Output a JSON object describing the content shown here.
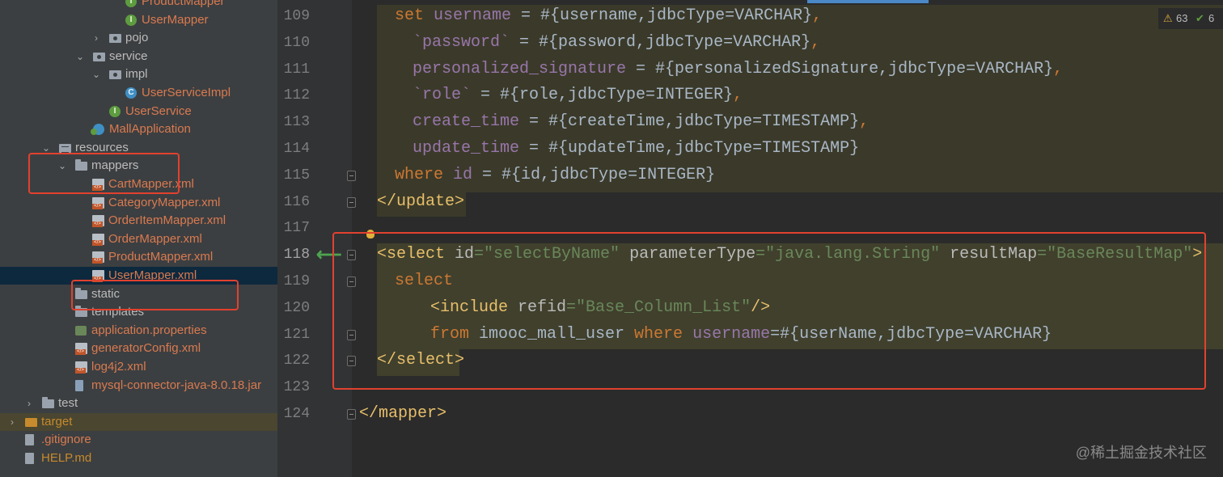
{
  "project_tree": {
    "items": [
      {
        "label": "ProductMapper",
        "icon": "interface-icon",
        "color": "orange",
        "indent": 155,
        "arrow": ""
      },
      {
        "label": "UserMapper",
        "icon": "interface-icon",
        "color": "orange",
        "indent": 155,
        "arrow": ""
      },
      {
        "label": "pojo",
        "icon": "package-icon",
        "color": "gray",
        "indent": 135,
        "arrow": "›"
      },
      {
        "label": "service",
        "icon": "package-icon",
        "color": "gray",
        "indent": 115,
        "arrow": "⌄"
      },
      {
        "label": "impl",
        "icon": "package-icon",
        "color": "gray",
        "indent": 135,
        "arrow": "⌄"
      },
      {
        "label": "UserServiceImpl",
        "icon": "class-icon",
        "color": "orange",
        "indent": 155,
        "arrow": ""
      },
      {
        "label": "UserService",
        "icon": "interface-icon",
        "color": "orange",
        "indent": 135,
        "arrow": ""
      },
      {
        "label": "MallApplication",
        "icon": "spring-app-icon",
        "color": "orange",
        "indent": 115,
        "arrow": ""
      },
      {
        "label": "resources",
        "icon": "resources-folder-icon",
        "color": "gray",
        "indent": 73,
        "arrow": "⌄"
      },
      {
        "label": "mappers",
        "icon": "folder-icon",
        "color": "gray",
        "indent": 93,
        "arrow": "⌄"
      },
      {
        "label": "CartMapper.xml",
        "icon": "xml-file-icon",
        "color": "orange",
        "indent": 114,
        "arrow": ""
      },
      {
        "label": "CategoryMapper.xml",
        "icon": "xml-file-icon",
        "color": "orange",
        "indent": 114,
        "arrow": ""
      },
      {
        "label": "OrderItemMapper.xml",
        "icon": "xml-file-icon",
        "color": "orange",
        "indent": 114,
        "arrow": ""
      },
      {
        "label": "OrderMapper.xml",
        "icon": "xml-file-icon",
        "color": "orange",
        "indent": 114,
        "arrow": ""
      },
      {
        "label": "ProductMapper.xml",
        "icon": "xml-file-icon",
        "color": "orange",
        "indent": 114,
        "arrow": ""
      },
      {
        "label": "UserMapper.xml",
        "icon": "xml-file-icon",
        "color": "orange",
        "indent": 114,
        "arrow": "",
        "selected": true
      },
      {
        "label": "static",
        "icon": "folder-icon",
        "color": "gray",
        "indent": 93,
        "arrow": ""
      },
      {
        "label": "templates",
        "icon": "folder-icon",
        "color": "gray",
        "indent": 93,
        "arrow": ""
      },
      {
        "label": "application.properties",
        "icon": "properties-file-icon",
        "color": "orange",
        "indent": 93,
        "arrow": ""
      },
      {
        "label": "generatorConfig.xml",
        "icon": "xml-file-icon",
        "color": "orange",
        "indent": 93,
        "arrow": ""
      },
      {
        "label": "log4j2.xml",
        "icon": "xml-file-icon",
        "color": "orange",
        "indent": 93,
        "arrow": ""
      },
      {
        "label": "mysql-connector-java-8.0.18.jar",
        "icon": "jar-file-icon",
        "color": "orange",
        "indent": 93,
        "arrow": ""
      },
      {
        "label": "test",
        "icon": "folder-icon",
        "color": "gray",
        "indent": 52,
        "arrow": "›"
      },
      {
        "label": "target",
        "icon": "target-folder-icon",
        "color": "gold",
        "indent": 31,
        "arrow": "›",
        "target": true
      },
      {
        "label": ".gitignore",
        "icon": "gitignore-file-icon",
        "color": "orange",
        "indent": 31,
        "arrow": ""
      },
      {
        "label": "HELP.md",
        "icon": "markdown-file-icon",
        "color": "gold",
        "indent": 31,
        "arrow": ""
      }
    ]
  },
  "editor": {
    "warnings": {
      "warning_count": "63",
      "ok_count": "6"
    },
    "lines": [
      {
        "num": "109",
        "html": [
          [
            "k",
            "set "
          ],
          [
            "v",
            "username"
          ],
          [
            "tp",
            " = #{username,jdbcType=VARCHAR}"
          ],
          [
            "k",
            ","
          ]
        ],
        "indent": 1
      },
      {
        "num": "110",
        "html": [
          [
            "v",
            "`password`"
          ],
          [
            "tp",
            " = #{password,jdbcType=VARCHAR}"
          ],
          [
            "k",
            ","
          ]
        ],
        "indent": 2
      },
      {
        "num": "111",
        "html": [
          [
            "v",
            "personalized_signature"
          ],
          [
            "tp",
            " = #{personalizedSignature,jdbcType=VARCHAR}"
          ],
          [
            "k",
            ","
          ]
        ],
        "indent": 2
      },
      {
        "num": "112",
        "html": [
          [
            "v",
            "`role`"
          ],
          [
            "tp",
            " = #{role,jdbcType=INTEGER}"
          ],
          [
            "k",
            ","
          ]
        ],
        "indent": 2
      },
      {
        "num": "113",
        "html": [
          [
            "v",
            "create_time"
          ],
          [
            "tp",
            " = #{createTime,jdbcType=TIMESTAMP}"
          ],
          [
            "k",
            ","
          ]
        ],
        "indent": 2
      },
      {
        "num": "114",
        "html": [
          [
            "v",
            "update_time"
          ],
          [
            "tp",
            " = #{updateTime,jdbcType=TIMESTAMP}"
          ]
        ],
        "indent": 2
      },
      {
        "num": "115",
        "html": [
          [
            "k",
            "where "
          ],
          [
            "v",
            "id"
          ],
          [
            "tp",
            " = #{id,jdbcType=INTEGER}"
          ]
        ],
        "indent": 1
      },
      {
        "num": "116",
        "html": [
          [
            "tg",
            "</update>"
          ]
        ],
        "indent": 0
      },
      {
        "num": "117",
        "html": [],
        "indent": 0
      },
      {
        "num": "118",
        "html": [
          [
            "tg",
            "<select "
          ],
          [
            "at",
            "id"
          ],
          [
            "s",
            "=\"selectByName\" "
          ],
          [
            "at",
            "parameterType"
          ],
          [
            "s",
            "=\"java.lang.String\" "
          ],
          [
            "at",
            "resultMap"
          ],
          [
            "s",
            "=\"BaseResultMap\""
          ],
          [
            "tg",
            ">"
          ]
        ],
        "indent": 0
      },
      {
        "num": "119",
        "html": [
          [
            "k",
            "select"
          ]
        ],
        "indent": 1
      },
      {
        "num": "120",
        "html": [
          [
            "tg",
            "<include "
          ],
          [
            "at",
            "refid"
          ],
          [
            "s",
            "=\"Base_Column_List\""
          ],
          [
            "tg",
            "/>"
          ]
        ],
        "indent": 3
      },
      {
        "num": "121",
        "html": [
          [
            "k",
            "from "
          ],
          [
            "tp",
            "imooc_mall_user "
          ],
          [
            "k",
            "where "
          ],
          [
            "v",
            "username"
          ],
          [
            "tp",
            "=#{userName,jdbcType=VARCHAR}"
          ]
        ],
        "indent": 3
      },
      {
        "num": "122",
        "html": [
          [
            "tg",
            "</select>"
          ]
        ],
        "indent": 0
      },
      {
        "num": "123",
        "html": [],
        "indent": 0
      },
      {
        "num": "124",
        "html": [
          [
            "tg",
            "</mapper>"
          ]
        ],
        "indent": -1
      }
    ]
  },
  "watermark": "@稀土掘金技术社区",
  "colors": {
    "annotation_red": "#e2412f",
    "selection_blue": "#0d293e",
    "keyword": "#cc7832",
    "string": "#6a8759",
    "tag": "#e8bf6a",
    "field": "#9876aa"
  }
}
